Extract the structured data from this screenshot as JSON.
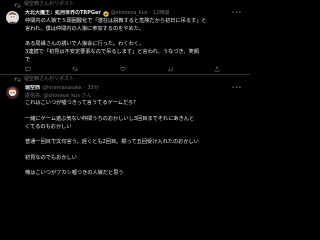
{
  "tweets": [
    {
      "repost_label": "堀空西さんがリポスト",
      "display_name": "大北大魔王：処刑世界のTRPGer",
      "handle": "@shoseya_kus",
      "time": "12時間",
      "lines": [
        "仲間内の人狼でＳ頭囲酸化で「潜在は説教すると危険だから初日に吊るす」と",
        "言われ、僕は仲間内の人狼に参加するのをやめた。",
        "",
        "ある局縁さんの誘いで人狼会に行った。わくわく。",
        "3連続で「初見は不安定要素なので吊るします」と言われ、うなづき、笑顔",
        "で"
      ]
    },
    {
      "repost_label": "堀空西さんがリポスト",
      "display_name": "堀空西",
      "handle": "@hiramasasake",
      "time": "33分",
      "handle_line": "返信先: @shoseya_kus さん",
      "lines": [
        "これはこいつが嘘つきって言うてるゲームだろ？",
        "",
        "一緒にゲーム遊ぶ気ない仲間うちのおかしいし3回目までそれにあきんと",
        "くてるのもおかしい",
        "",
        "普通一回目で文句言う。遅くとも2回目。黙って五回受け入れたのおかしい",
        "",
        "初見なのでもおかしい",
        "",
        "俺はこいつがフカシ嘘つきの人狼だと思う"
      ]
    }
  ],
  "icons": {
    "repost": "repost-icon",
    "verified": "verified-badge-icon",
    "more": "more-options-icon",
    "reply": "reply-icon",
    "retweet": "retweet-icon",
    "like": "like-icon",
    "views": "views-icon",
    "bookmark": "bookmark-icon",
    "share": "share-icon"
  },
  "colors": {
    "background": "#000000",
    "text": "#e7e9ea",
    "secondary": "#71767b",
    "verified": "#f4c542",
    "divider": "#2f3336"
  }
}
